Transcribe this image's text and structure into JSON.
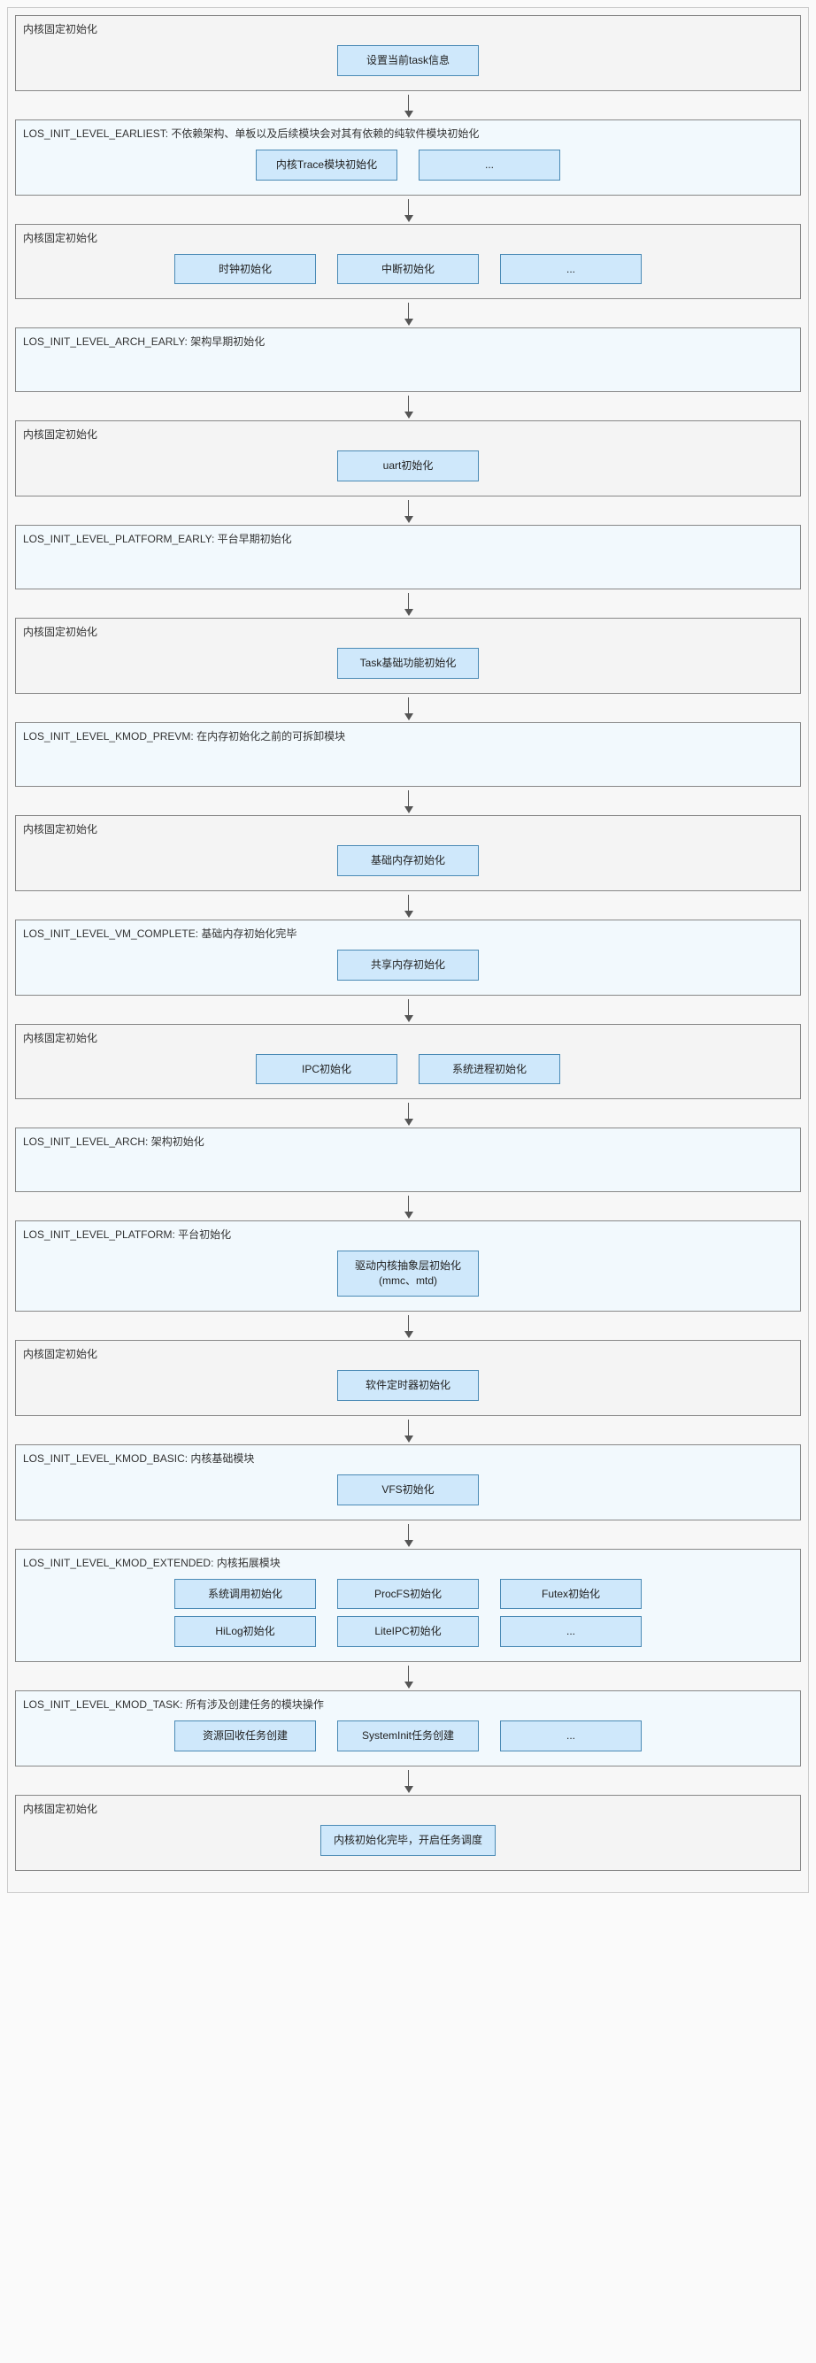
{
  "labels": {
    "fixed_init": "内核固定初始化"
  },
  "stages": [
    {
      "type": "fixed",
      "title_key": "fixed_init",
      "boxes": [
        "设置当前task信息"
      ]
    },
    {
      "type": "level",
      "title": "LOS_INIT_LEVEL_EARLIEST: 不依赖架构、单板以及后续模块会对其有依赖的纯软件模块初始化",
      "boxes": [
        "内核Trace模块初始化",
        "..."
      ]
    },
    {
      "type": "fixed",
      "title_key": "fixed_init",
      "boxes": [
        "时钟初始化",
        "中断初始化",
        "..."
      ]
    },
    {
      "type": "level",
      "title": "LOS_INIT_LEVEL_ARCH_EARLY: 架构早期初始化",
      "boxes": [],
      "spacer": true
    },
    {
      "type": "fixed",
      "title_key": "fixed_init",
      "boxes": [
        "uart初始化"
      ]
    },
    {
      "type": "level",
      "title": "LOS_INIT_LEVEL_PLATFORM_EARLY: 平台早期初始化",
      "boxes": [],
      "spacer": true
    },
    {
      "type": "fixed",
      "title_key": "fixed_init",
      "boxes": [
        "Task基础功能初始化"
      ]
    },
    {
      "type": "level",
      "title": "LOS_INIT_LEVEL_KMOD_PREVM: 在内存初始化之前的可拆卸模块",
      "boxes": [],
      "spacer": true
    },
    {
      "type": "fixed",
      "title_key": "fixed_init",
      "boxes": [
        "基础内存初始化"
      ]
    },
    {
      "type": "level",
      "title": "LOS_INIT_LEVEL_VM_COMPLETE: 基础内存初始化完毕",
      "boxes": [
        "共享内存初始化"
      ]
    },
    {
      "type": "fixed",
      "title_key": "fixed_init",
      "boxes": [
        "IPC初始化",
        "系统进程初始化"
      ]
    },
    {
      "type": "level",
      "title": "LOS_INIT_LEVEL_ARCH: 架构初始化",
      "boxes": [],
      "spacer": true
    },
    {
      "type": "level",
      "title": "LOS_INIT_LEVEL_PLATFORM: 平台初始化",
      "boxes": [
        "驱动内核抽象层初始化\n(mmc、mtd)"
      ]
    },
    {
      "type": "fixed",
      "title_key": "fixed_init",
      "boxes": [
        "软件定时器初始化"
      ]
    },
    {
      "type": "level",
      "title": "LOS_INIT_LEVEL_KMOD_BASIC: 内核基础模块",
      "boxes": [
        "VFS初始化"
      ]
    },
    {
      "type": "level",
      "title": "LOS_INIT_LEVEL_KMOD_EXTENDED: 内核拓展模块",
      "rows": [
        [
          "系统调用初始化",
          "ProcFS初始化",
          "Futex初始化"
        ],
        [
          "HiLog初始化",
          "LiteIPC初始化",
          "..."
        ]
      ]
    },
    {
      "type": "level",
      "title": "LOS_INIT_LEVEL_KMOD_TASK: 所有涉及创建任务的模块操作",
      "boxes": [
        "资源回收任务创建",
        "SystemInit任务创建",
        "..."
      ]
    },
    {
      "type": "fixed",
      "title_key": "fixed_init",
      "boxes": [
        "内核初始化完毕，开启任务调度"
      ],
      "last": true
    }
  ],
  "dependency_arrows": [
    {
      "from": "Task基础功能初始化",
      "to": "内核Trace模块初始化"
    },
    {
      "from": "uart初始化",
      "to": "中断初始化"
    },
    {
      "from": "共享内存初始化",
      "to": "基础内存初始化"
    },
    {
      "from": "VFS初始化",
      "to": "驱动内核抽象层初始化"
    },
    {
      "from": "系统调用初始化",
      "to": "VFS初始化"
    },
    {
      "from": "ProcFS初始化",
      "to": "VFS初始化"
    },
    {
      "from": "HiLog初始化",
      "to": "VFS初始化"
    },
    {
      "from": "LiteIPC初始化",
      "to": "VFS初始化"
    },
    {
      "from": "SystemInit任务创建",
      "to": "VFS初始化"
    },
    {
      "from": "SystemInit任务创建",
      "to": "驱动内核抽象层初始化"
    }
  ],
  "chart_data": {
    "type": "flowchart",
    "direction": "top-to-bottom",
    "note": "Main flow proceeds sequentially through each stage via solid black arrows. Blue arrows (dependency_arrows) show init-dependency back-references from later boxes to earlier boxes."
  }
}
